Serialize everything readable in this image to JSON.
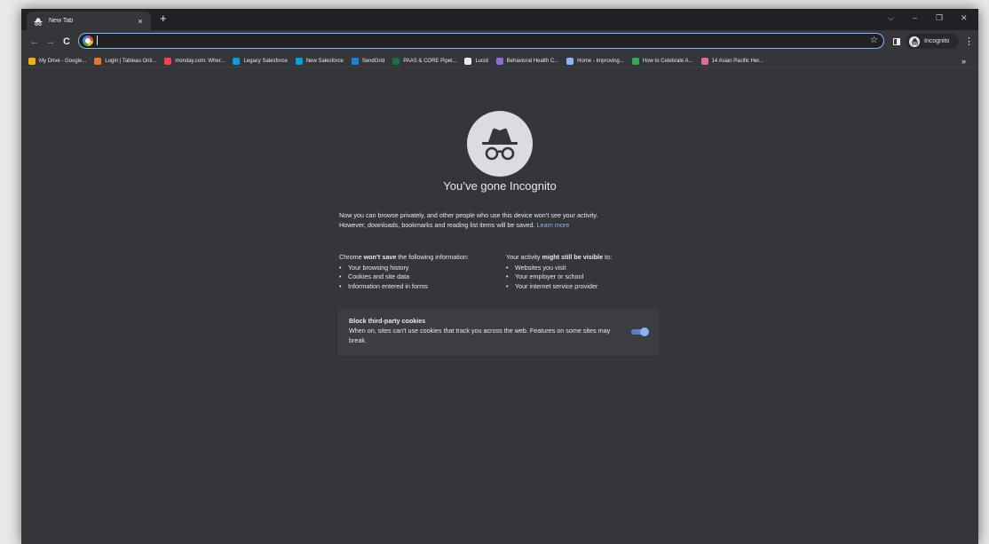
{
  "tab": {
    "title": "New Tab",
    "close": "×",
    "new_tab": "+"
  },
  "window_controls": {
    "tabsearch": "⌵",
    "minimize": "–",
    "restore": "❐",
    "close": "✕"
  },
  "toolbar": {
    "back": "←",
    "forward": "→",
    "reload": "C",
    "address_value": "",
    "address_placeholder": "",
    "bookmark_star": "☆",
    "profile_label": "Incognito",
    "menu": "⋮"
  },
  "bookmarks": [
    {
      "label": "My Drive - Google...",
      "icon": "google-drive-icon",
      "color": "#f4b400"
    },
    {
      "label": "Login | Tableau Onli...",
      "icon": "tableau-icon",
      "color": "#e97627"
    },
    {
      "label": "monday.com: Wher...",
      "icon": "monday-icon",
      "color": "#ff3d57"
    },
    {
      "label": "Legacy Salesforce",
      "icon": "salesforce-icon",
      "color": "#00a1e0"
    },
    {
      "label": "New Salesforce",
      "icon": "salesforce-icon",
      "color": "#00a1e0"
    },
    {
      "label": "SendGrid",
      "icon": "sendgrid-icon",
      "color": "#1a82e2"
    },
    {
      "label": "PAAS & CORE Pipel...",
      "icon": "excel-icon",
      "color": "#1d6f42"
    },
    {
      "label": "Lucid",
      "icon": "lucid-icon",
      "color": "#e8eaed"
    },
    {
      "label": "Behavioral Health C...",
      "icon": "lucid-purple-icon",
      "color": "#8e6dd8"
    },
    {
      "label": "Home - Improving...",
      "icon": "globe-icon",
      "color": "#8ab4f8"
    },
    {
      "label": "How to Celebrate A...",
      "icon": "green-circle-icon",
      "color": "#34a853"
    },
    {
      "label": "14 Asian Pacific Her...",
      "icon": "pink-square-icon",
      "color": "#e06c9f"
    }
  ],
  "bookmarks_more": "»",
  "incognito": {
    "heading": "You’ve gone Incognito",
    "para_line1": "Now you can browse privately, and other people who use this device won’t see your activity.",
    "para_line2": "However, downloads, bookmarks and reading list items will be saved.",
    "learn_more": "Learn more",
    "left_col": {
      "head_pre": "Chrome ",
      "head_bold": "won’t save",
      "head_post": " the following information:",
      "items": [
        "Your browsing history",
        "Cookies and site data",
        "Information entered in forms"
      ]
    },
    "right_col": {
      "head_pre": "Your activity ",
      "head_bold": "might still be visible",
      "head_post": " to:",
      "items": [
        "Websites you visit",
        "Your employer or school",
        "Your internet service provider"
      ]
    },
    "cookies": {
      "title": "Block third-party cookies",
      "desc": "When on, sites can't use cookies that track you across the web. Features on some sites may break.",
      "enabled": true
    }
  },
  "colors": {
    "accent": "#8ab4f8",
    "page_bg": "#35363a",
    "tabstrip_bg": "#202124"
  }
}
